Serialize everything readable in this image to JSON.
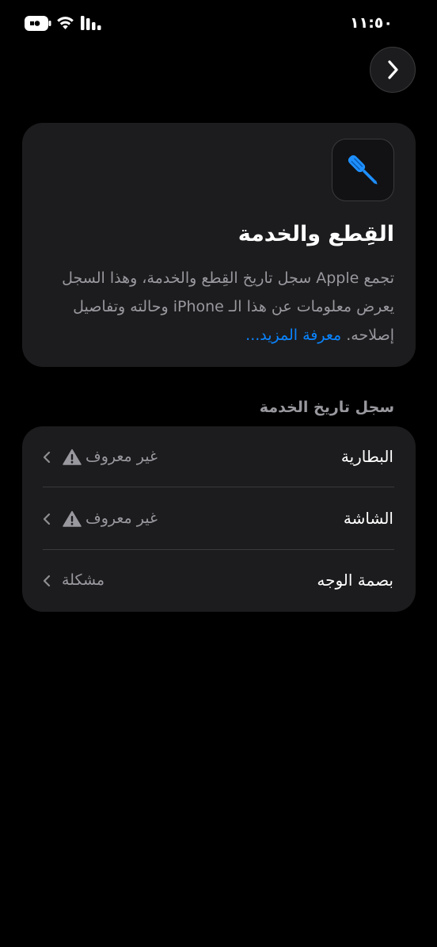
{
  "status_bar": {
    "time": "١١:٥٠"
  },
  "card": {
    "title": "القِطع والخدمة",
    "body": "تجمع Apple سجل تاريخ القِطع والخدمة، وهذا السجل يعرض معلومات عن هذا الـ iPhone وحالته وتفاصيل إصلاحه.",
    "learn_more": "معرفة المزيد..."
  },
  "section": {
    "header": "سجل تاريخ الخدمة"
  },
  "rows": [
    {
      "label": "البطارية",
      "value": "غير معروف",
      "warning": true
    },
    {
      "label": "الشاشة",
      "value": "غير معروف",
      "warning": true
    },
    {
      "label": "بصمة الوجه",
      "value": "مشكلة",
      "warning": false
    }
  ],
  "colors": {
    "accent": "#0a84ff",
    "background": "#000000",
    "card": "#1c1c1e",
    "secondary_text": "#98989e"
  }
}
